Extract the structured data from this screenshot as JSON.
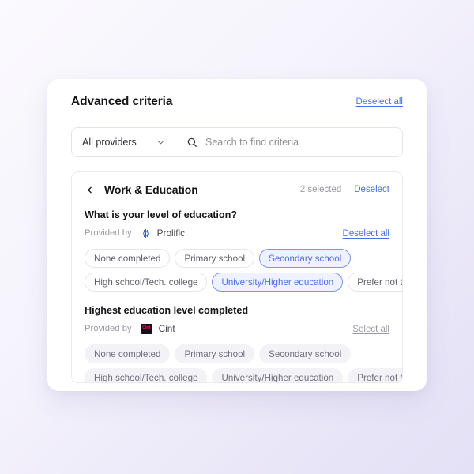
{
  "header": {
    "title": "Advanced criteria",
    "deselect_all_label": "Deselect all"
  },
  "search": {
    "provider_selected": "All providers",
    "placeholder": "Search to find criteria",
    "value": "",
    "search_icon": "search-icon",
    "chevron_icon": "chevron-down-icon"
  },
  "section": {
    "back_icon": "chevron-left-icon",
    "title": "Work & Education",
    "selected_count": "2 selected",
    "deselect_label": "Deselect"
  },
  "groups": [
    {
      "question": "What is your level of education?",
      "provided_by_label": "Provided by",
      "provider_name": "Prolific",
      "provider_logo": "prolific-logo-icon",
      "action_label": "Deselect all",
      "action_style": "blue",
      "options": [
        {
          "label": "None completed",
          "state": "plain"
        },
        {
          "label": "Primary school",
          "state": "plain"
        },
        {
          "label": "Secondary school",
          "state": "selected"
        },
        {
          "label": "High school/Tech. college",
          "state": "plain"
        },
        {
          "label": "University/Higher education",
          "state": "selected"
        },
        {
          "label": "Prefer not to answer",
          "state": "plain"
        }
      ]
    },
    {
      "question": "Highest education level completed",
      "provided_by_label": "Provided by",
      "provider_name": "Cint",
      "provider_logo": "cint-logo-icon",
      "provider_logo_text": "Cint",
      "action_label": "Select all",
      "action_style": "gray",
      "options": [
        {
          "label": "None completed",
          "state": "muted"
        },
        {
          "label": "Primary school",
          "state": "muted"
        },
        {
          "label": "Secondary school",
          "state": "muted"
        },
        {
          "label": "High school/Tech. college",
          "state": "muted"
        },
        {
          "label": "University/Higher education",
          "state": "muted"
        },
        {
          "label": "Prefer not to answer",
          "state": "muted"
        }
      ]
    }
  ],
  "colors": {
    "accent_blue": "#4B6FEA",
    "chip_selected_border": "#7A94F2",
    "chip_selected_bg": "#EFF2FE",
    "cint_red": "#E8174A",
    "text_dark": "#15161A",
    "text_muted": "#9A9AA6"
  }
}
